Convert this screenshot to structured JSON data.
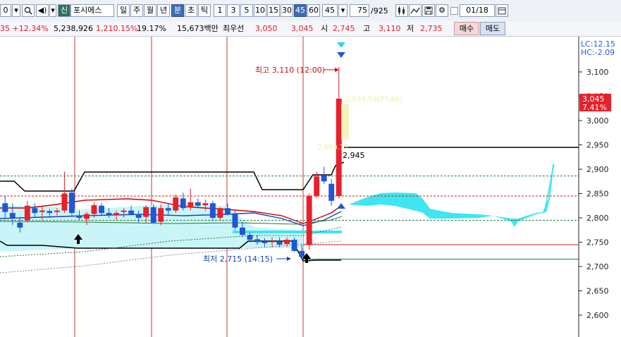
{
  "toolbar": {
    "code_value": "0",
    "badge_new": "신",
    "stock_name": "포시에스",
    "periods": [
      "일",
      "주",
      "월",
      "년",
      "분",
      "초",
      "틱"
    ],
    "intervals": [
      "1",
      "3",
      "5",
      "10",
      "15",
      "30",
      "45",
      "60"
    ],
    "interval_value": "45",
    "count_value": "75",
    "count_total": "/925",
    "date_value": "01/18",
    "active_period": "분",
    "active_interval": "45"
  },
  "info": {
    "change": "35 +12.34%",
    "volume": "5,238,926",
    "volume_rate": "1,210.15%",
    "turnover": "19.17%",
    "amount": "15,673백만",
    "best_label": "최우선",
    "best_ask": "3,050",
    "best_bid": "3,045",
    "open_label": "시",
    "open": "2,745",
    "high_label": "고",
    "high": "3,110",
    "low_label": "저",
    "low": "2,735",
    "buy_label": "매수",
    "sell_label": "매도"
  },
  "chart": {
    "lc_label": "LC:12.15",
    "hc_label": "HC:-2.09",
    "y_ticks": [
      "3,100",
      "3,050",
      "3,000",
      "2,950",
      "2,900",
      "2,850",
      "2,800",
      "2,750",
      "2,700",
      "2,650",
      "2,600"
    ],
    "current_price": "3,045",
    "current_pct": "7.41%",
    "high_annotation": "최고 3,110 (12:00)",
    "low_annotation": "최저 2,715 (14:15)",
    "value_label_2945": "2,945",
    "yellow_label_1": "3,034,59(77.80)",
    "yellow_label_2": "2,960.77",
    "colors": {
      "up": "#e8202a",
      "down": "#1f57d6",
      "cloud": "#3ee6f0",
      "frame": "#1a1a1a"
    }
  },
  "chart_data": {
    "type": "candlestick",
    "ylim": [
      2580,
      3130
    ],
    "y_ticks": [
      3100,
      3050,
      3000,
      2950,
      2900,
      2850,
      2800,
      2750,
      2700,
      2650,
      2600
    ],
    "current_price": 3045,
    "candles": [
      {
        "o": 2830,
        "h": 2845,
        "l": 2800,
        "c": 2812
      },
      {
        "o": 2810,
        "h": 2830,
        "l": 2785,
        "c": 2800
      },
      {
        "o": 2790,
        "h": 2800,
        "l": 2770,
        "c": 2780
      },
      {
        "o": 2795,
        "h": 2835,
        "l": 2790,
        "c": 2825
      },
      {
        "o": 2820,
        "h": 2830,
        "l": 2800,
        "c": 2810
      },
      {
        "o": 2812,
        "h": 2822,
        "l": 2795,
        "c": 2815
      },
      {
        "o": 2814,
        "h": 2818,
        "l": 2800,
        "c": 2810
      },
      {
        "o": 2812,
        "h": 2820,
        "l": 2805,
        "c": 2815
      },
      {
        "o": 2815,
        "h": 2895,
        "l": 2810,
        "c": 2850
      },
      {
        "o": 2852,
        "h": 2860,
        "l": 2805,
        "c": 2810
      },
      {
        "o": 2805,
        "h": 2815,
        "l": 2795,
        "c": 2800
      },
      {
        "o": 2798,
        "h": 2812,
        "l": 2785,
        "c": 2808
      },
      {
        "o": 2808,
        "h": 2832,
        "l": 2800,
        "c": 2826
      },
      {
        "o": 2825,
        "h": 2830,
        "l": 2805,
        "c": 2810
      },
      {
        "o": 2810,
        "h": 2820,
        "l": 2800,
        "c": 2805
      },
      {
        "o": 2805,
        "h": 2815,
        "l": 2795,
        "c": 2810
      },
      {
        "o": 2812,
        "h": 2820,
        "l": 2800,
        "c": 2815
      },
      {
        "o": 2815,
        "h": 2825,
        "l": 2805,
        "c": 2808
      },
      {
        "o": 2808,
        "h": 2815,
        "l": 2790,
        "c": 2800
      },
      {
        "o": 2802,
        "h": 2826,
        "l": 2790,
        "c": 2822
      },
      {
        "o": 2822,
        "h": 2828,
        "l": 2790,
        "c": 2790
      },
      {
        "o": 2792,
        "h": 2828,
        "l": 2785,
        "c": 2820
      },
      {
        "o": 2820,
        "h": 2830,
        "l": 2805,
        "c": 2815
      },
      {
        "o": 2815,
        "h": 2848,
        "l": 2810,
        "c": 2842
      },
      {
        "o": 2840,
        "h": 2852,
        "l": 2815,
        "c": 2820
      },
      {
        "o": 2822,
        "h": 2860,
        "l": 2815,
        "c": 2832
      },
      {
        "o": 2832,
        "h": 2840,
        "l": 2820,
        "c": 2825
      },
      {
        "o": 2826,
        "h": 2838,
        "l": 2815,
        "c": 2830
      },
      {
        "o": 2830,
        "h": 2835,
        "l": 2796,
        "c": 2800
      },
      {
        "o": 2800,
        "h": 2822,
        "l": 2795,
        "c": 2820
      },
      {
        "o": 2820,
        "h": 2830,
        "l": 2805,
        "c": 2808
      },
      {
        "o": 2808,
        "h": 2815,
        "l": 2775,
        "c": 2780
      },
      {
        "o": 2780,
        "h": 2792,
        "l": 2760,
        "c": 2765
      },
      {
        "o": 2765,
        "h": 2770,
        "l": 2750,
        "c": 2755
      },
      {
        "o": 2756,
        "h": 2765,
        "l": 2745,
        "c": 2750
      },
      {
        "o": 2752,
        "h": 2758,
        "l": 2740,
        "c": 2748
      },
      {
        "o": 2750,
        "h": 2760,
        "l": 2740,
        "c": 2752
      },
      {
        "o": 2752,
        "h": 2760,
        "l": 2740,
        "c": 2745
      },
      {
        "o": 2746,
        "h": 2760,
        "l": 2740,
        "c": 2755
      },
      {
        "o": 2755,
        "h": 2760,
        "l": 2730,
        "c": 2732
      },
      {
        "o": 2732,
        "h": 2745,
        "l": 2715,
        "c": 2720
      },
      {
        "o": 2745,
        "h": 2850,
        "l": 2735,
        "c": 2845
      },
      {
        "o": 2845,
        "h": 2895,
        "l": 2840,
        "c": 2885
      },
      {
        "o": 2888,
        "h": 2905,
        "l": 2870,
        "c": 2875
      },
      {
        "o": 2870,
        "h": 2880,
        "l": 2825,
        "c": 2835
      },
      {
        "o": 2845,
        "h": 3110,
        "l": 2840,
        "c": 3045
      }
    ],
    "levels": {
      "recent_high": 2945,
      "resistance": 2845,
      "support_upper": 2795,
      "support_lower": 2745,
      "low_line": 2715,
      "dashed_green": 2886
    },
    "annotations": {
      "high": 3110,
      "low": 2715
    }
  }
}
